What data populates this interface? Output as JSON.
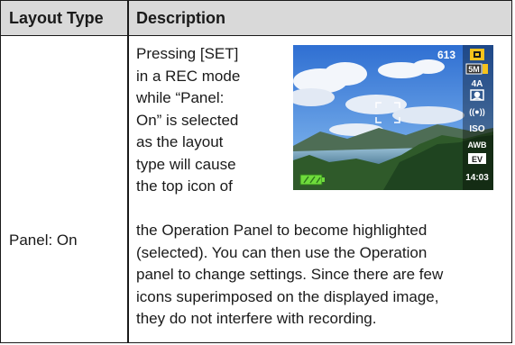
{
  "table": {
    "headers": {
      "layout_type": "Layout Type",
      "description": "Description"
    },
    "row": {
      "layout_type": "Panel: On",
      "description_lines_top": [
        "Pressing [SET]",
        "in a REC mode",
        "while “Panel:",
        "On” is selected",
        "as the layout",
        "type will cause",
        "the top icon of"
      ],
      "description_lines_full": [
        "the Operation Panel to become highlighted",
        "(selected). You can then use the Operation",
        "panel to change settings. Since there are few",
        "icons superimposed on the displayed image,",
        "they do not interfere with recording."
      ]
    }
  },
  "camera_screen": {
    "shots_remaining": "613",
    "image_size": "5M",
    "flash": "4A",
    "anti_shake": "((●))",
    "iso": "ISO",
    "white_balance": "AWB",
    "exposure": "EV",
    "time": "14:03",
    "colors": {
      "highlight": "#f6c31c",
      "battery": "#6fdc3c",
      "sky": "#4a8be0"
    }
  }
}
